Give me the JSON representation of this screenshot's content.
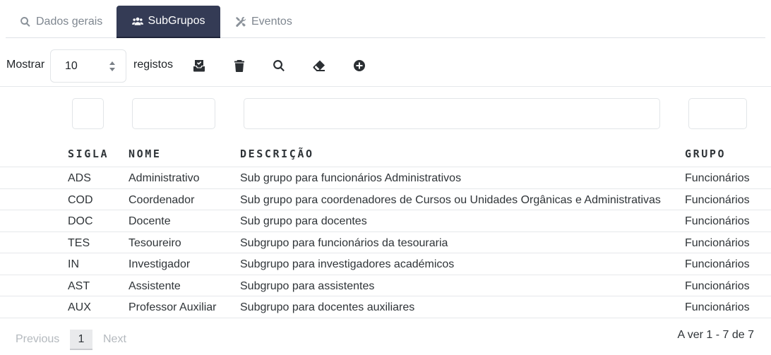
{
  "tabs": [
    {
      "label": "Dados gerais",
      "icon": "search-icon"
    },
    {
      "label": "SubGrupos",
      "icon": "users-icon"
    },
    {
      "label": "Eventos",
      "icon": "tools-icon"
    }
  ],
  "toolbar": {
    "show_label": "Mostrar",
    "page_size": "10",
    "records_label": "registos",
    "icons": [
      "export-icon",
      "trash-icon",
      "search-icon",
      "eraser-icon",
      "add-circle-icon"
    ]
  },
  "table": {
    "headers": [
      "SIGLA",
      "NOME",
      "DESCRIÇÃO",
      "GRUPO"
    ],
    "rows": [
      [
        "ADS",
        "Administrativo",
        "Sub grupo para funcionários Administrativos",
        "Funcionários"
      ],
      [
        "COD",
        "Coordenador",
        "Sub grupo para coordenadores de Cursos ou Unidades Orgânicas e Administrativas",
        "Funcionários"
      ],
      [
        "DOC",
        "Docente",
        "Sub grupo para docentes",
        "Funcionários"
      ],
      [
        "TES",
        "Tesoureiro",
        "Subgrupo para funcionários da tesouraria",
        "Funcionários"
      ],
      [
        "IN",
        "Investigador",
        "Subgrupo para investigadores académicos",
        "Funcionários"
      ],
      [
        "AST",
        "Assistente",
        "Subgrupo para assistentes",
        "Funcionários"
      ],
      [
        "AUX",
        "Professor Auxiliar",
        "Subgrupo para docentes auxiliares",
        "Funcionários"
      ]
    ]
  },
  "pagination": {
    "previous": "Previous",
    "current": "1",
    "next": "Next",
    "info": "A ver 1 - 7 de 7"
  },
  "colors": {
    "active_tab": "#343b55",
    "text": "#2f3438",
    "muted": "#7f8790"
  }
}
